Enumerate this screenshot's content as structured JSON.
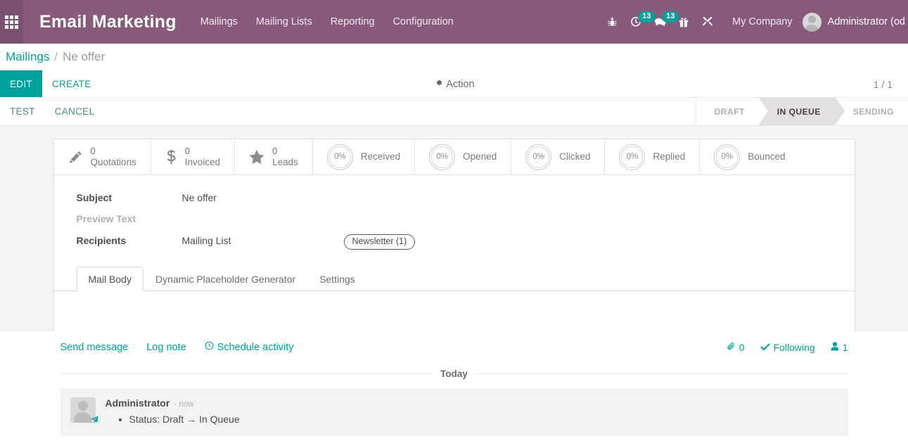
{
  "navbar": {
    "apps_icon": "grid-apps-icon",
    "brand": "Email Marketing",
    "menu": [
      {
        "label": "Mailings"
      },
      {
        "label": "Mailing Lists"
      },
      {
        "label": "Reporting"
      },
      {
        "label": "Configuration"
      }
    ],
    "icons": [
      {
        "name": "bug-icon",
        "badge": null
      },
      {
        "name": "activity-clock-icon",
        "badge": "13"
      },
      {
        "name": "messages-chat-icon",
        "badge": "13"
      },
      {
        "name": "gift-icon",
        "badge": null
      },
      {
        "name": "tools-wrench-icon",
        "badge": null
      }
    ],
    "company": "My Company",
    "user": "Administrator (od",
    "accent_purple": "#875A7B",
    "badge_color": "#00A09D"
  },
  "breadcrumb": {
    "root": "Mailings",
    "separator": "/",
    "current": "Ne offer"
  },
  "control_panel": {
    "edit_label": "EDIT",
    "create_label": "CREATE",
    "action_label": "Action",
    "action_icon": "gear-icon",
    "pager": "1 / 1"
  },
  "status_row": {
    "test_label": "TEST",
    "cancel_label": "CANCEL",
    "steps": [
      {
        "label": "DRAFT",
        "active": false
      },
      {
        "label": "IN QUEUE",
        "active": true
      },
      {
        "label": "SENDING",
        "active": false
      }
    ]
  },
  "stat_buttons": [
    {
      "icon": "pencil-icon",
      "value": "0",
      "label": "Quotations",
      "kind": "count"
    },
    {
      "icon": "dollar-icon",
      "value": "0",
      "label": "Invoiced",
      "kind": "count"
    },
    {
      "icon": "star-icon",
      "value": "0",
      "label": "Leads",
      "kind": "count"
    },
    {
      "icon": "percent-ring-icon",
      "value": "0%",
      "label": "Received",
      "kind": "ring"
    },
    {
      "icon": "percent-ring-icon",
      "value": "0%",
      "label": "Opened",
      "kind": "ring"
    },
    {
      "icon": "percent-ring-icon",
      "value": "0%",
      "label": "Clicked",
      "kind": "ring"
    },
    {
      "icon": "percent-ring-icon",
      "value": "0%",
      "label": "Replied",
      "kind": "ring"
    },
    {
      "icon": "percent-ring-icon",
      "value": "0%",
      "label": "Bounced",
      "kind": "ring"
    }
  ],
  "form": {
    "subject_label": "Subject",
    "subject_value": "Ne offer",
    "preview_label": "Preview Text",
    "preview_value": "",
    "recipients_label": "Recipients",
    "recipients_value": "Mailing List",
    "mailing_list_tag": "Newsletter (1)"
  },
  "tabs": [
    {
      "label": "Mail Body",
      "active": true
    },
    {
      "label": "Dynamic Placeholder Generator",
      "active": false
    },
    {
      "label": "Settings",
      "active": false
    }
  ],
  "chatter": {
    "send_message": "Send message",
    "log_note": "Log note",
    "schedule_activity": "Schedule activity",
    "schedule_icon": "clock-icon",
    "attachment_icon": "paperclip-icon",
    "attachment_count": "0",
    "following_icon": "check-icon",
    "following_label": "Following",
    "followers_icon": "user-icon",
    "followers_count": "1",
    "date_divider": "Today",
    "message": {
      "author": "Administrator",
      "time": "- now",
      "avatar_badge_icon": "paper-plane-icon",
      "lines": [
        "Status: Draft → In Queue"
      ]
    }
  }
}
